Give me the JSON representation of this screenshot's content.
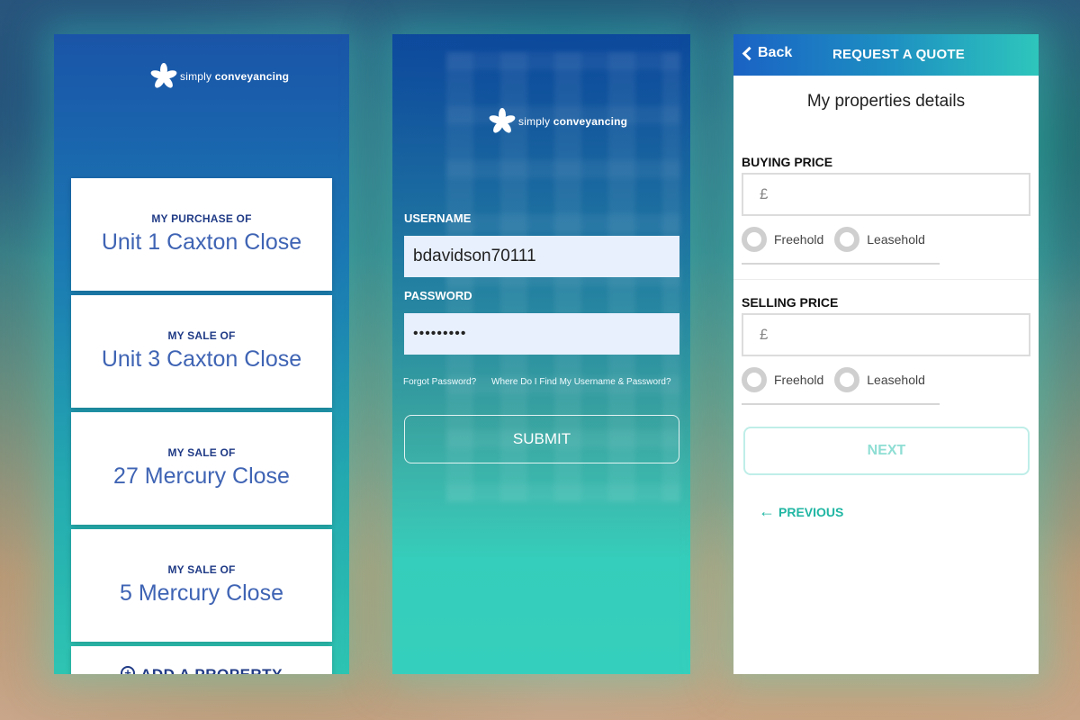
{
  "colors": {
    "accent_blue": "#1a54a8",
    "accent_teal": "#2ec4b2",
    "card_text": "#203b86",
    "next_text": "#8fded4",
    "prev_text": "#20b6a3"
  },
  "brand": {
    "prefix": "simply",
    "name": "conveyancing"
  },
  "properties_screen": {
    "cards": [
      {
        "caption": "MY PURCHASE OF",
        "address": "Unit 1 Caxton Close"
      },
      {
        "caption": "MY SALE OF",
        "address": "Unit 3 Caxton Close"
      },
      {
        "caption": "MY SALE OF",
        "address": "27 Mercury Close"
      },
      {
        "caption": "MY SALE OF",
        "address": "5 Mercury Close"
      }
    ],
    "add_property": {
      "icon": "plus-circle-icon",
      "label": "ADD A PROPERTY"
    }
  },
  "login_screen": {
    "username_label": "USERNAME",
    "username_value": "bdavidson70111",
    "password_label": "PASSWORD",
    "password_value": "•••••••••",
    "forgot_link": "Forgot Password?",
    "help_link": "Where Do I Find My Username & Password?",
    "submit": "SUBMIT"
  },
  "quote_screen": {
    "back": "Back",
    "title": "REQUEST A QUOTE",
    "heading": "My properties details",
    "buying": {
      "label": "BUYING PRICE",
      "currency": "£",
      "options": [
        "Freehold",
        "Leasehold"
      ]
    },
    "selling": {
      "label": "SELLING PRICE",
      "currency": "£",
      "options": [
        "Freehold",
        "Leasehold"
      ]
    },
    "next": "NEXT",
    "previous": "PREVIOUS"
  }
}
